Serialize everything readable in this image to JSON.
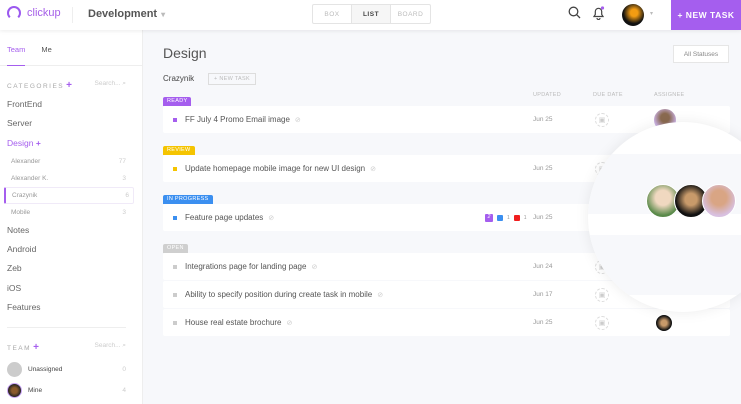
{
  "top": {
    "logo": "clickup",
    "workspace": "Development",
    "views": [
      "BOX",
      "LIST",
      "BOARD"
    ],
    "active_view": "LIST",
    "new_task": "+ NEW TASK"
  },
  "sidebar": {
    "tabs": [
      "Team",
      "Me"
    ],
    "categories_label": "CATEGORIES",
    "search": "Search...",
    "categories": [
      "FrontEnd",
      "Server",
      "Design"
    ],
    "design_lists": [
      {
        "name": "Alexander",
        "count": "77"
      },
      {
        "name": "Alexander K.",
        "count": "3"
      },
      {
        "name": "Crazynik",
        "count": "6"
      },
      {
        "name": "Mobile",
        "count": "3"
      }
    ],
    "more_categories": [
      "Notes",
      "Android",
      "Zeb",
      "iOS",
      "Features"
    ],
    "team_label": "TEAM",
    "members": [
      {
        "name": "Unassigned",
        "count": "0"
      },
      {
        "name": "Mine",
        "count": "4"
      }
    ]
  },
  "main": {
    "title": "Design",
    "all_statuses": "All Statuses",
    "list_name": "Crazynik",
    "new_task": "+ NEW TASK",
    "columns": [
      "UPDATED",
      "DUE DATE",
      "ASSIGNEE"
    ],
    "groups": [
      {
        "status": "READY",
        "color": "#a55eee",
        "tasks": [
          {
            "name": "FF July 4 Promo Email image",
            "updated": "Jun 25"
          }
        ]
      },
      {
        "status": "REVIEW",
        "color": "#f5c400",
        "tasks": [
          {
            "name": "Update homepage mobile image for new UI design",
            "updated": "Jun 25"
          }
        ]
      },
      {
        "status": "IN PROGRESS",
        "color": "#3b8ff0",
        "tasks": [
          {
            "name": "Feature page updates",
            "updated": "Jun 25",
            "badges": [
              "2",
              "1",
              "1"
            ]
          }
        ]
      },
      {
        "status": "OPEN",
        "color": "#cfcfcf",
        "tasks": [
          {
            "name": "Integrations page for landing page",
            "updated": "Jun 24"
          },
          {
            "name": "Ability to specify position during create task in mobile",
            "updated": "Jun 17"
          },
          {
            "name": "House real estate brochure",
            "updated": "Jun 25"
          }
        ]
      }
    ]
  }
}
